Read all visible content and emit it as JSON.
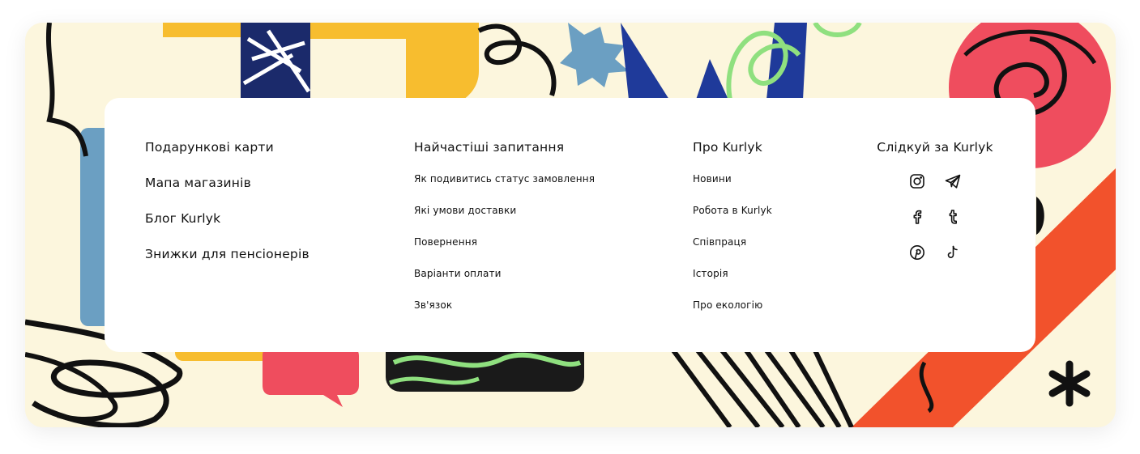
{
  "footer": {
    "primary_links": [
      {
        "label": "Подарункові карти"
      },
      {
        "label": "Мапа магазинів"
      },
      {
        "label": "Блог Kurlyk"
      },
      {
        "label": "Знижки для пенсіонерів"
      }
    ],
    "faq": {
      "heading": "Найчастіші запитання",
      "links": [
        {
          "label": "Як подивитись статус замовлення"
        },
        {
          "label": "Які умови доставки"
        },
        {
          "label": "Повернення"
        },
        {
          "label": "Варіанти оплати"
        },
        {
          "label": "Зв'язок"
        }
      ]
    },
    "about": {
      "heading": "Про Kurlyk",
      "links": [
        {
          "label": "Новини"
        },
        {
          "label": "Робота в Kurlyk"
        },
        {
          "label": "Співпраця"
        },
        {
          "label": "Історія"
        },
        {
          "label": "Про екологію"
        }
      ]
    },
    "social": {
      "heading": "Слідкуй за Kurlyk",
      "icons": [
        "instagram-icon",
        "telegram-icon",
        "facebook-icon",
        "tumblr-icon",
        "pinterest-icon",
        "tiktok-icon"
      ]
    }
  },
  "colors": {
    "background": "#fcf6dd",
    "card": "#ffffff",
    "text": "#111111",
    "accent_yellow": "#f7bd2f",
    "accent_red": "#ef4d5e",
    "accent_orange": "#f2522c",
    "accent_blue": "#1f3a9a",
    "accent_light_blue": "#6b9fc2",
    "accent_green": "#8fe07f"
  }
}
